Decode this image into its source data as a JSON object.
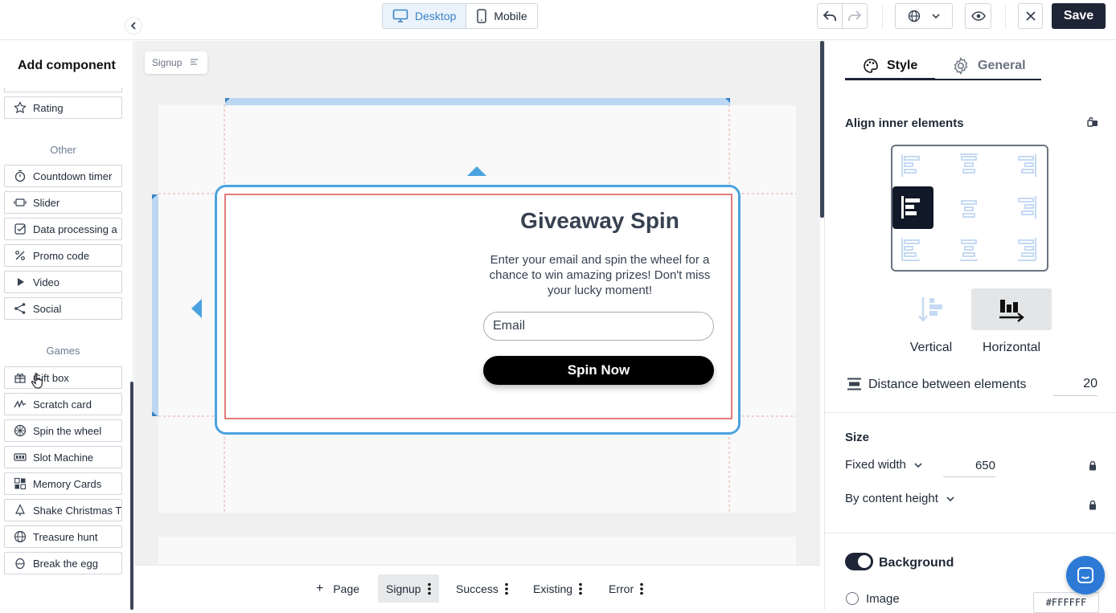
{
  "topbar": {
    "desktop_label": "Desktop",
    "mobile_label": "Mobile",
    "save_label": "Save"
  },
  "sidebar": {
    "title": "Add component",
    "items_top": [
      {
        "label": "Rating",
        "icon": "star-icon"
      }
    ],
    "other_heading": "Other",
    "other_items": [
      {
        "label": "Countdown timer",
        "icon": "timer-icon"
      },
      {
        "label": "Slider",
        "icon": "slider-icon"
      },
      {
        "label": "Data processing a",
        "icon": "checkbox-icon"
      },
      {
        "label": "Promo code",
        "icon": "percent-icon"
      },
      {
        "label": "Video",
        "icon": "play-icon"
      },
      {
        "label": "Social",
        "icon": "share-icon"
      }
    ],
    "games_heading": "Games",
    "games_items": [
      {
        "label": "Gift box",
        "icon": "gift-icon"
      },
      {
        "label": "Scratch card",
        "icon": "scratch-icon"
      },
      {
        "label": "Spin the wheel",
        "icon": "wheel-icon"
      },
      {
        "label": "Slot Machine",
        "icon": "slot-icon"
      },
      {
        "label": "Memory Cards",
        "icon": "cards-icon"
      },
      {
        "label": "Shake Christmas T",
        "icon": "tree-icon"
      },
      {
        "label": "Treasure hunt",
        "icon": "globe-icon"
      },
      {
        "label": "Break the egg",
        "icon": "egg-icon"
      }
    ]
  },
  "canvas": {
    "breadcrumb": "Signup",
    "popup": {
      "title": "Giveaway Spin",
      "description": "Enter your email and spin the wheel for a chance to win amazing prizes! Don't miss your lucky moment!",
      "email_placeholder": "Email",
      "button_label": "Spin Now"
    }
  },
  "page_tabs": {
    "add_label": "Page",
    "tabs": [
      "Signup",
      "Success",
      "Existing",
      "Error"
    ],
    "active": "Signup"
  },
  "panel": {
    "tab_style": "Style",
    "tab_general": "General",
    "align_heading": "Align inner elements",
    "vertical_label": "Vertical",
    "horizontal_label": "Horizontal",
    "distance_label": "Distance between elements",
    "distance_value": "20",
    "size_heading": "Size",
    "width_mode": "Fixed width",
    "width_value": "650",
    "height_mode": "By content height",
    "background_label": "Background",
    "image_label": "Image",
    "bg_color": "#FFFFFF"
  },
  "colors": {
    "accent": "#3b82c4",
    "selection": "#4aa3df",
    "dark": "#1e2536"
  }
}
